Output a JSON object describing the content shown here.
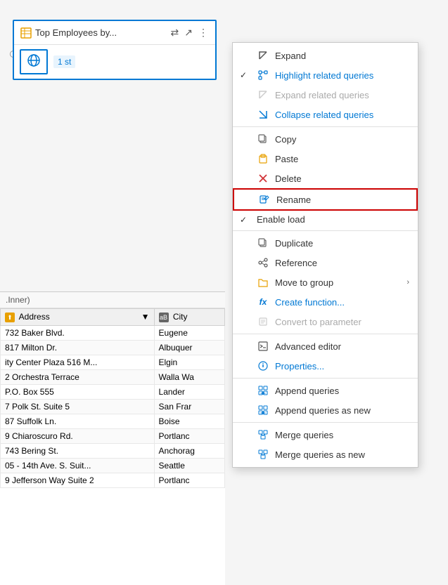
{
  "queryCard": {
    "title": "Top Employees by...",
    "steps": "1 st",
    "badgeSymbol": "⇄"
  },
  "tableLabel": ".Inner)",
  "tableColumns": [
    "Address",
    "City"
  ],
  "tableData": [
    [
      "732 Baker Blvd.",
      "Eugene"
    ],
    [
      "817 Milton Dr.",
      "Albuquer"
    ],
    [
      "ity Center Plaza 516 M...",
      "Elgin"
    ],
    [
      "2 Orchestra Terrace",
      "Walla Wa"
    ],
    [
      "P.O. Box 555",
      "Lander"
    ],
    [
      "7 Polk St. Suite 5",
      "San Frar"
    ],
    [
      "87 Suffolk Ln.",
      "Boise"
    ],
    [
      "9 Chiaroscuro Rd.",
      "Portlanc"
    ],
    [
      "743 Bering St.",
      "Anchorag"
    ],
    [
      "05 - 14th Ave. S. Suit...",
      "Seattle"
    ],
    [
      "9 Jefferson Way Suite 2",
      "Portlanc"
    ]
  ],
  "contextMenu": {
    "items": [
      {
        "id": "expand",
        "icon": "↗",
        "iconClass": "gray",
        "label": "Expand",
        "labelClass": "black",
        "check": "",
        "hasArrow": false,
        "disabled": false,
        "separator": false
      },
      {
        "id": "highlight-related",
        "icon": "🔗",
        "iconClass": "blue",
        "label": "Highlight related queries",
        "labelClass": "blue",
        "check": "✓",
        "hasArrow": false,
        "disabled": false,
        "separator": false
      },
      {
        "id": "expand-related",
        "icon": "↗",
        "iconClass": "gray",
        "label": "Expand related queries",
        "labelClass": "gray",
        "check": "",
        "hasArrow": false,
        "disabled": true,
        "separator": false
      },
      {
        "id": "collapse-related",
        "icon": "↙",
        "iconClass": "gray",
        "label": "Collapse related queries",
        "labelClass": "blue",
        "check": "",
        "hasArrow": false,
        "disabled": false,
        "separator": true
      },
      {
        "id": "copy",
        "icon": "📄",
        "iconClass": "gray",
        "label": "Copy",
        "labelClass": "black",
        "check": "",
        "hasArrow": false,
        "disabled": false,
        "separator": false
      },
      {
        "id": "paste",
        "icon": "📋",
        "iconClass": "orange",
        "label": "Paste",
        "labelClass": "black",
        "check": "",
        "hasArrow": false,
        "disabled": false,
        "separator": false
      },
      {
        "id": "delete",
        "icon": "✕",
        "iconClass": "red",
        "label": "Delete",
        "labelClass": "black",
        "check": "",
        "hasArrow": false,
        "disabled": false,
        "separator": false
      },
      {
        "id": "rename",
        "icon": "✏",
        "iconClass": "blue",
        "label": "Rename",
        "labelClass": "black",
        "check": "",
        "hasArrow": false,
        "disabled": false,
        "separator": false,
        "highlighted": true
      },
      {
        "id": "enable-load",
        "icon": "",
        "iconClass": "gray",
        "label": "Enable load",
        "labelClass": "black",
        "check": "✓",
        "hasArrow": false,
        "disabled": false,
        "separator": true
      },
      {
        "id": "duplicate",
        "icon": "📄",
        "iconClass": "gray",
        "label": "Duplicate",
        "labelClass": "black",
        "check": "",
        "hasArrow": false,
        "disabled": false,
        "separator": false
      },
      {
        "id": "reference",
        "icon": "🔗",
        "iconClass": "gray",
        "label": "Reference",
        "labelClass": "black",
        "check": "",
        "hasArrow": false,
        "disabled": false,
        "separator": false
      },
      {
        "id": "move-to-group",
        "icon": "📁",
        "iconClass": "orange",
        "label": "Move to group",
        "labelClass": "black",
        "check": "",
        "hasArrow": true,
        "disabled": false,
        "separator": false
      },
      {
        "id": "create-function",
        "icon": "fx",
        "iconClass": "blue",
        "label": "Create function...",
        "labelClass": "blue",
        "check": "",
        "hasArrow": false,
        "disabled": false,
        "separator": false
      },
      {
        "id": "convert-param",
        "icon": "☰",
        "iconClass": "gray",
        "label": "Convert to parameter",
        "labelClass": "gray",
        "check": "",
        "hasArrow": false,
        "disabled": true,
        "separator": true
      },
      {
        "id": "advanced-editor",
        "icon": "📝",
        "iconClass": "gray",
        "label": "Advanced editor",
        "labelClass": "black",
        "check": "",
        "hasArrow": false,
        "disabled": false,
        "separator": false
      },
      {
        "id": "properties",
        "icon": "⚙",
        "iconClass": "blue",
        "label": "Properties...",
        "labelClass": "blue",
        "check": "",
        "hasArrow": false,
        "disabled": false,
        "separator": true
      },
      {
        "id": "append-queries",
        "icon": "⇓",
        "iconClass": "blue",
        "label": "Append queries",
        "labelClass": "black",
        "check": "",
        "hasArrow": false,
        "disabled": false,
        "separator": false
      },
      {
        "id": "append-queries-new",
        "icon": "⇓",
        "iconClass": "blue",
        "label": "Append queries as new",
        "labelClass": "black",
        "check": "",
        "hasArrow": false,
        "disabled": false,
        "separator": true
      },
      {
        "id": "merge-queries",
        "icon": "⇒",
        "iconClass": "blue",
        "label": "Merge queries",
        "labelClass": "black",
        "check": "",
        "hasArrow": false,
        "disabled": false,
        "separator": false
      },
      {
        "id": "merge-queries-new",
        "icon": "⇒",
        "iconClass": "blue",
        "label": "Merge queries as new",
        "labelClass": "black",
        "check": "",
        "hasArrow": false,
        "disabled": false,
        "separator": false
      }
    ]
  }
}
